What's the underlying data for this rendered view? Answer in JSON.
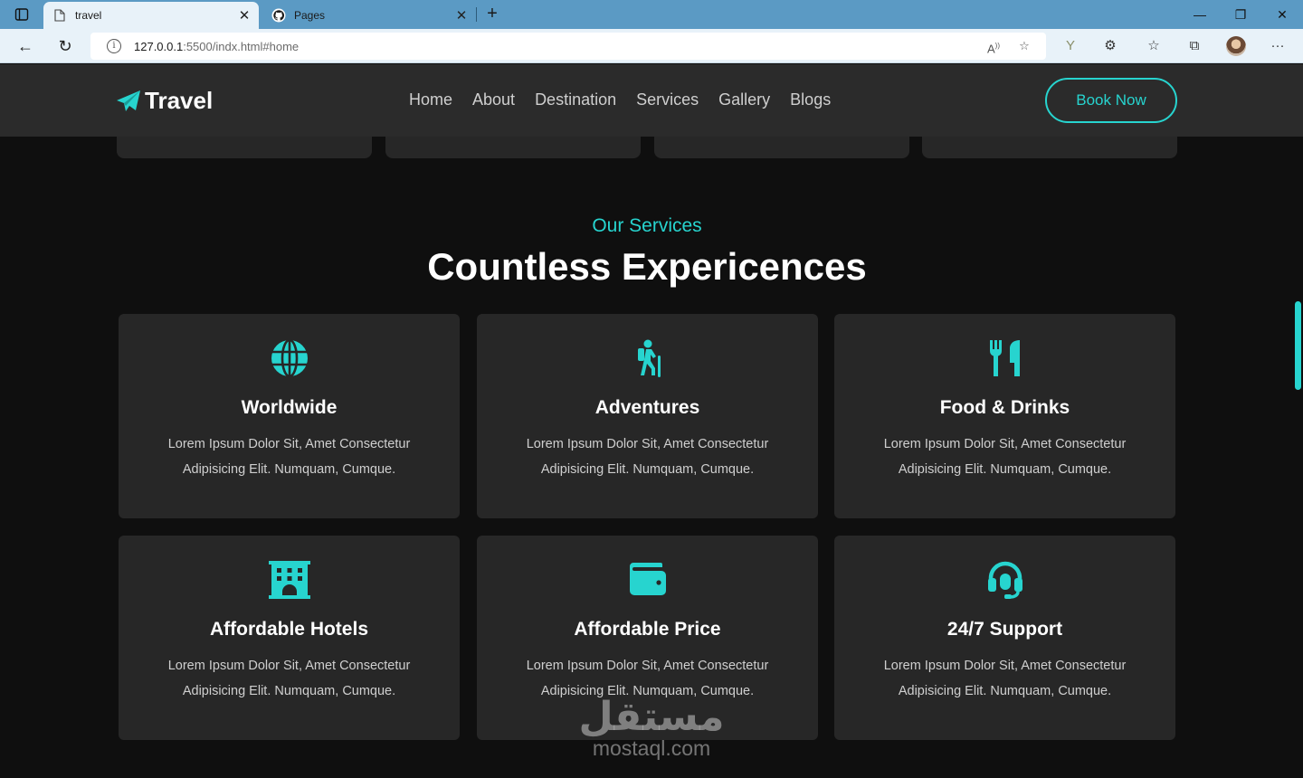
{
  "browser": {
    "tabs": [
      {
        "title": "travel",
        "icon": "page-icon",
        "active": true
      },
      {
        "title": "Pages",
        "icon": "github-icon",
        "active": false
      }
    ],
    "url_host": "127.0.0.1",
    "url_rest": ":5500/indx.html#home"
  },
  "header": {
    "logo_text": "Travel",
    "menu": [
      "Home",
      "About",
      "Destination",
      "Services",
      "Gallery",
      "Blogs"
    ],
    "cta_label": "Book Now"
  },
  "services": {
    "subtitle": "Our Services",
    "title": "Countless Expericences",
    "cards": [
      {
        "icon": "globe-icon",
        "title": "Worldwide",
        "line1": "Lorem Ipsum Dolor Sit, Amet Consectetur",
        "line2": "Adipisicing Elit. Numquam, Cumque."
      },
      {
        "icon": "hiking-icon",
        "title": "Adventures",
        "line1": "Lorem Ipsum Dolor Sit, Amet Consectetur",
        "line2": "Adipisicing Elit. Numquam, Cumque."
      },
      {
        "icon": "utensils-icon",
        "title": "Food & Drinks",
        "line1": "Lorem Ipsum Dolor Sit, Amet Consectetur",
        "line2": "Adipisicing Elit. Numquam, Cumque."
      },
      {
        "icon": "hotel-icon",
        "title": "Affordable Hotels",
        "line1": "Lorem Ipsum Dolor Sit, Amet Consectetur",
        "line2": "Adipisicing Elit. Numquam, Cumque."
      },
      {
        "icon": "wallet-icon",
        "title": "Affordable Price",
        "line1": "Lorem Ipsum Dolor Sit, Amet Consectetur",
        "line2": "Adipisicing Elit. Numquam, Cumque."
      },
      {
        "icon": "headset-icon",
        "title": "24/7 Support",
        "line1": "Lorem Ipsum Dolor Sit, Amet Consectetur",
        "line2": "Adipisicing Elit. Numquam, Cumque."
      }
    ]
  },
  "watermark": {
    "arabic": "مستقل",
    "latin": "mostaql.com"
  },
  "colors": {
    "accent": "#27d4cf",
    "background": "#0f0f0f",
    "card": "#272727",
    "header": "#2b2b2b"
  }
}
